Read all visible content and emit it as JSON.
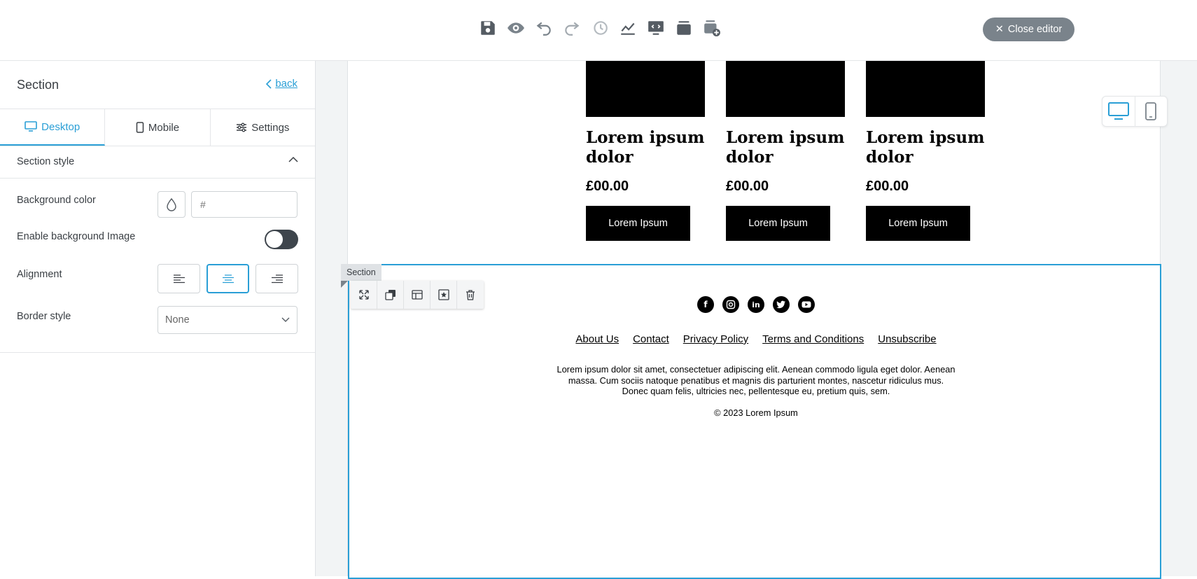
{
  "toolbar": {
    "icons": [
      "save-icon",
      "preview-icon",
      "undo-icon",
      "redo-icon",
      "history-icon",
      "analytics-icon",
      "monitor-code-icon",
      "layers-icon",
      "add-block-icon"
    ],
    "close_label": "Close editor"
  },
  "panel": {
    "title": "Section",
    "back_label": "back",
    "tabs": [
      {
        "label": "Desktop",
        "icon": "desktop-icon",
        "active": true
      },
      {
        "label": "Mobile",
        "icon": "mobile-icon",
        "active": false
      },
      {
        "label": "Settings",
        "icon": "sliders-icon",
        "active": false
      }
    ],
    "section_style_label": "Section style",
    "background_color_label": "Background color",
    "background_color_placeholder": "#",
    "enable_bg_image_label": "Enable background Image",
    "alignment_label": "Alignment",
    "alignment_selected": "center",
    "border_style_label": "Border style",
    "border_style_value": "None"
  },
  "email": {
    "products": [
      {
        "name": "Lorem ipsum dolor",
        "price": "£00.00",
        "cta": "Lorem Ipsum"
      },
      {
        "name": "Lorem ipsum dolor",
        "price": "£00.00",
        "cta": "Lorem Ipsum"
      },
      {
        "name": "Lorem ipsum dolor",
        "price": "£00.00",
        "cta": "Lorem Ipsum"
      }
    ],
    "section_tag": "Section",
    "social": [
      "facebook-icon",
      "instagram-icon",
      "linkedin-icon",
      "twitter-icon",
      "youtube-icon"
    ],
    "links": [
      "About Us",
      "Contact",
      "Privacy Policy",
      "Terms and Conditions",
      "Unsubscribe"
    ],
    "footer_text": "Lorem ipsum dolor sit amet, consectetuer adipiscing elit. Aenean commodo ligula eget dolor. Aenean massa. Cum sociis natoque penatibus et magnis dis parturient montes, nascetur ridiculus mus. Donec quam felis, ultricies nec, pellentesque eu, pretium quis, sem.",
    "copyright": "© 2023 Lorem Ipsum"
  },
  "colors": {
    "accent": "#2a9fd6",
    "dark": "#3e454c",
    "close_button": "#7a838b"
  }
}
